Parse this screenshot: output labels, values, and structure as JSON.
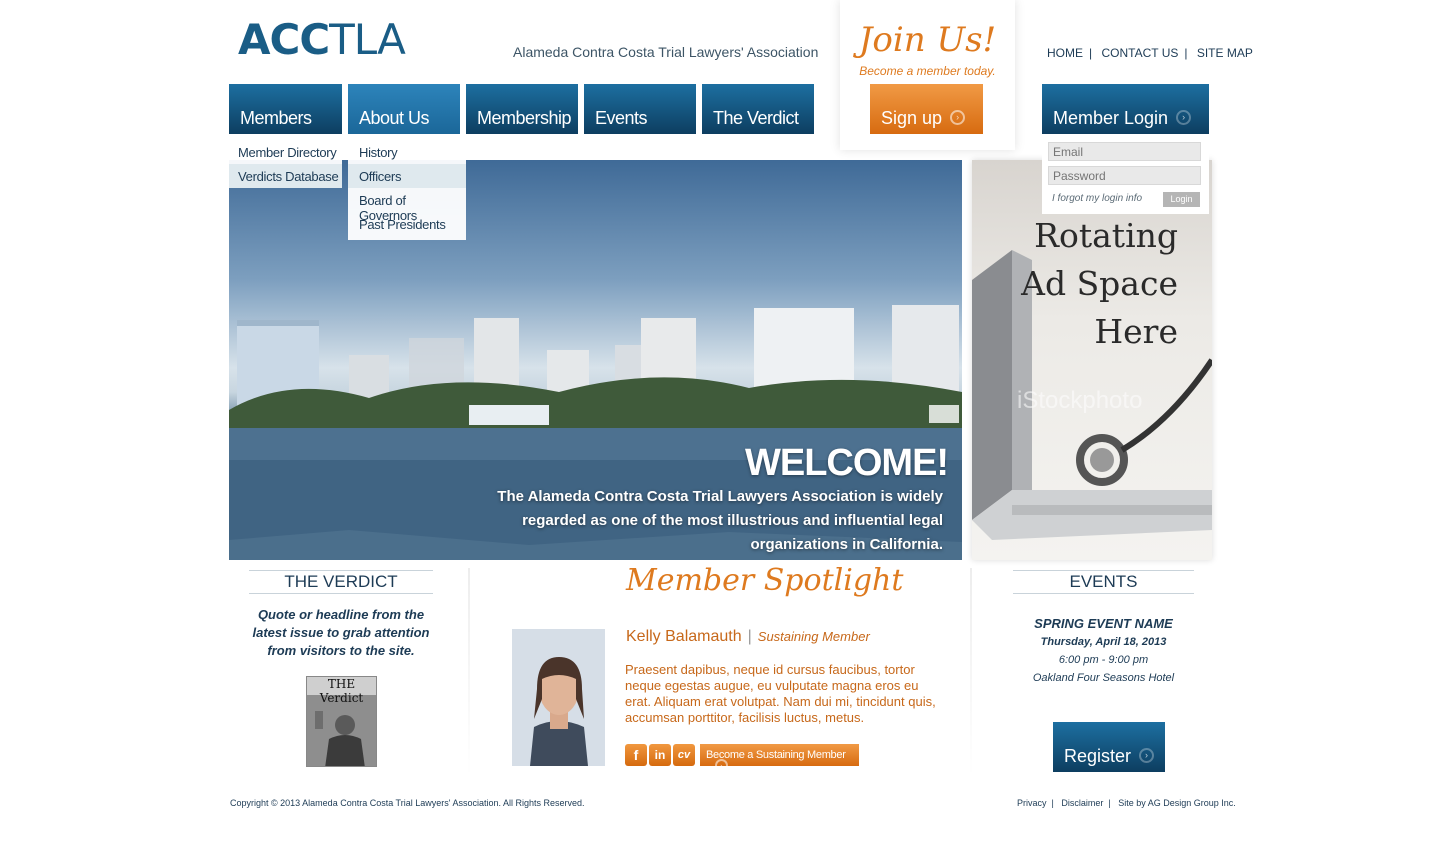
{
  "header": {
    "logo_bold": "ACC",
    "logo_light": "TLA",
    "tagline": "Alameda Contra Costa Trial Lawyers' Association",
    "join_title": "Join Us!",
    "join_subtitle": "Become a member today.",
    "signup_label": "Sign up",
    "top_links": [
      "HOME",
      "CONTACT US",
      "SITE MAP"
    ]
  },
  "nav": {
    "items": [
      "Members",
      "About Us",
      "Membership",
      "Events",
      "The Verdict"
    ],
    "members_dropdown": [
      "Member Directory",
      "Verdicts Database"
    ],
    "about_dropdown": [
      "History",
      "Officers",
      "Board of Governors",
      "Past Presidents"
    ]
  },
  "login": {
    "title": "Member Login",
    "email_placeholder": "Email",
    "password_placeholder": "Password",
    "forgot": "I forgot my login info",
    "button": "Login"
  },
  "hero": {
    "title": "WELCOME!",
    "text": "The Alameda Contra Costa Trial Lawyers Association is widely regarded as one of the most illustrious and influential legal organizations in California."
  },
  "ad": {
    "line1": "Rotating",
    "line2": "Ad Space",
    "line3": "Here",
    "watermark": "iStockphoto"
  },
  "verdict": {
    "title": "THE VERDICT",
    "quote": "Quote or headline from the latest issue to grab attention from visitors to the site.",
    "magazine_title": "THE Verdict"
  },
  "spotlight": {
    "title": "Member Spotlight",
    "name": "Kelly Balamauth",
    "level": "Sustaining Member",
    "text": "Praesent dapibus, neque id cursus faucibus, tortor neque egestas augue, eu vulputate magna eros eu erat. Aliquam erat volutpat. Nam dui mi, tincidunt quis, accumsan porttitor, facilisis luctus, metus.",
    "social": [
      "f",
      "in",
      "cv"
    ],
    "become_button": "Become a Sustaining Member"
  },
  "events": {
    "title": "EVENTS",
    "name": "SPRING EVENT NAME",
    "date": "Thursday, April 18, 2013",
    "time": "6:00 pm - 9:00 pm",
    "venue": "Oakland Four Seasons Hotel",
    "register": "Register"
  },
  "footer": {
    "copyright": "Copyright © 2013 Alameda Contra Costa Trial Lawyers' Association. All Rights Reserved.",
    "links": [
      "Privacy",
      "Disclaimer",
      "Site by AG Design Group Inc."
    ]
  },
  "colors": {
    "navy": "#1d3b55",
    "nav_blue": "#0d3e60",
    "orange": "#de7a1f"
  }
}
